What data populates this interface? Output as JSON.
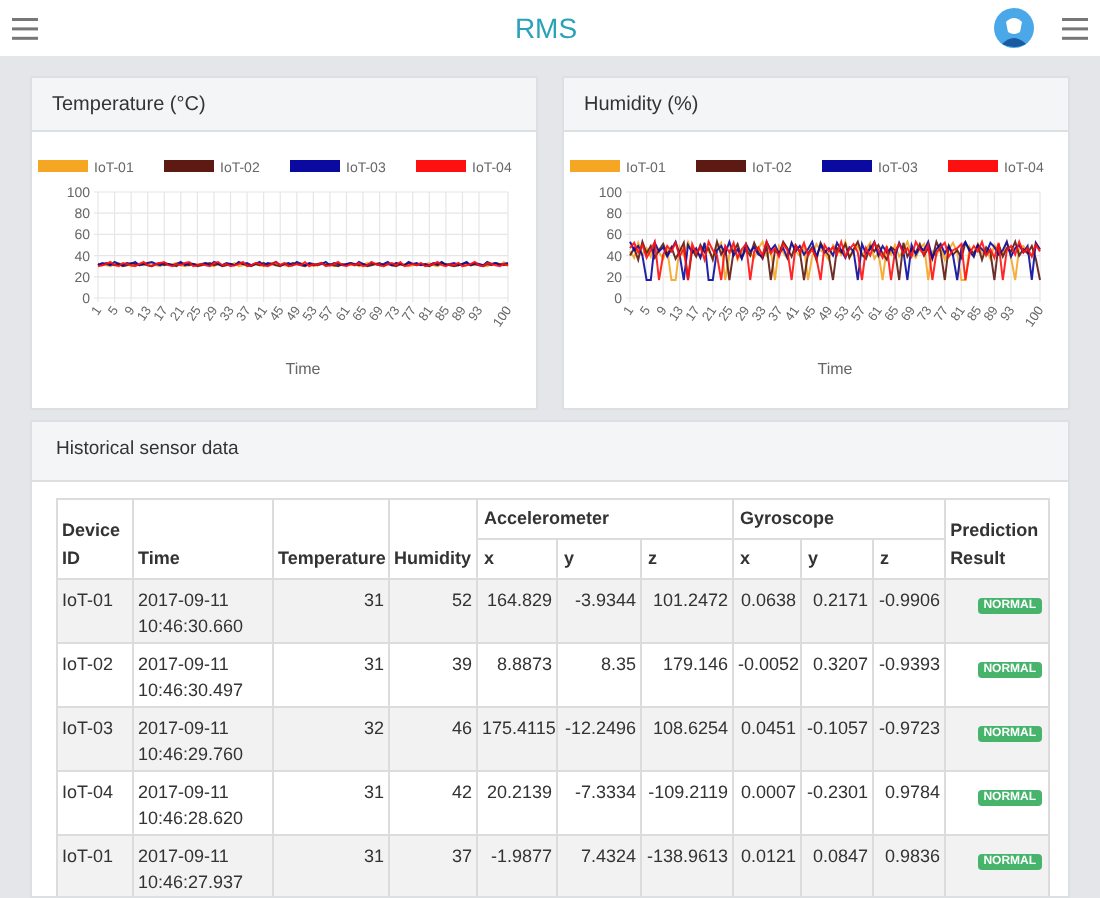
{
  "header": {
    "title": "RMS"
  },
  "charts": [
    {
      "title": "Temperature (°C)",
      "chart_data": {
        "type": "line",
        "grid": true,
        "legend": true,
        "xlim": [
          1,
          100
        ],
        "xlabel": "Time",
        "x": [
          1,
          2,
          3,
          4,
          5,
          6,
          7,
          8,
          9,
          10,
          11,
          12,
          13,
          14,
          15,
          16,
          17,
          18,
          19,
          20,
          21,
          22,
          23,
          24,
          25,
          26,
          27,
          28,
          29,
          30,
          31,
          32,
          33,
          34,
          35,
          36,
          37,
          38,
          39,
          40,
          41,
          42,
          43,
          44,
          45,
          46,
          47,
          48,
          49,
          50,
          51,
          52,
          53,
          54,
          55,
          56,
          57,
          58,
          59,
          60,
          61,
          62,
          63,
          64,
          65,
          66,
          67,
          68,
          69,
          70,
          71,
          72,
          73,
          74,
          75,
          76,
          77,
          78,
          79,
          80,
          81,
          82,
          83,
          84,
          85,
          86,
          87,
          88,
          89,
          90,
          91,
          92,
          93,
          94,
          95,
          96,
          97,
          98,
          99,
          100
        ],
        "ylim": [
          0,
          100
        ],
        "yticks": [
          0,
          20,
          40,
          60,
          80,
          100
        ],
        "xticks": [
          1,
          5,
          9,
          13,
          17,
          21,
          25,
          29,
          33,
          37,
          41,
          45,
          49,
          53,
          57,
          61,
          65,
          69,
          73,
          77,
          81,
          85,
          89,
          93,
          100
        ],
        "series": [
          {
            "name": "IoT-01",
            "color": "#f5a623",
            "values": [
              31,
              32,
              31,
              30,
              32,
              33,
              31,
              32,
              30,
              31,
              32,
              31,
              33,
              32,
              31,
              30,
              32,
              31,
              32,
              33,
              31,
              30,
              31,
              32,
              32,
              31,
              33,
              31,
              30,
              32,
              31,
              32,
              31,
              33,
              30,
              31,
              32,
              31,
              32,
              31,
              30,
              32,
              33,
              31,
              32,
              31,
              30,
              31,
              32,
              33,
              31,
              32,
              30,
              31,
              33,
              32,
              31,
              30,
              32,
              31,
              32,
              31,
              32,
              30,
              31,
              33,
              31,
              32,
              31,
              30,
              32,
              31,
              33,
              31,
              32,
              30,
              31,
              32,
              31,
              32,
              33,
              31,
              30,
              32,
              31,
              32,
              31,
              33,
              30,
              31,
              32,
              31,
              32,
              31,
              30,
              32,
              33,
              31,
              34,
              30
            ]
          },
          {
            "name": "IoT-02",
            "color": "#5c1a12",
            "values": [
              32,
              31,
              33,
              32,
              31,
              32,
              30,
              31,
              33,
              32,
              31,
              32,
              31,
              30,
              32,
              33,
              31,
              32,
              31,
              30,
              33,
              32,
              31,
              32,
              30,
              31,
              32,
              33,
              31,
              32,
              30,
              31,
              32,
              31,
              33,
              32,
              31,
              30,
              32,
              31,
              33,
              31,
              32,
              31,
              30,
              32,
              31,
              33,
              32,
              31,
              30,
              32,
              31,
              32,
              33,
              31,
              32,
              31,
              30,
              32,
              31,
              33,
              32,
              31,
              32,
              30,
              31,
              32,
              33,
              31,
              32,
              31,
              30,
              32,
              31,
              33,
              32,
              31,
              32,
              31,
              30,
              32,
              31,
              33,
              32,
              31,
              30,
              31,
              32,
              33,
              31,
              32,
              31,
              30,
              32,
              31,
              33,
              32,
              31,
              32
            ]
          },
          {
            "name": "IoT-03",
            "color": "#0a0aa0",
            "values": [
              31,
              33,
              32,
              31,
              34,
              32,
              31,
              33,
              32,
              34,
              31,
              32,
              33,
              34,
              32,
              31,
              33,
              32,
              31,
              32,
              34,
              31,
              33,
              32,
              31,
              32,
              33,
              31,
              34,
              32,
              31,
              33,
              32,
              31,
              34,
              32,
              33,
              31,
              32,
              34,
              31,
              33,
              32,
              34,
              31,
              32,
              33,
              31,
              34,
              32,
              31,
              33,
              32,
              31,
              32,
              34,
              31,
              33,
              32,
              31,
              32,
              33,
              31,
              34,
              32,
              31,
              33,
              32,
              31,
              32,
              34,
              31,
              33,
              32,
              31,
              34,
              32,
              33,
              31,
              32,
              31,
              33,
              32,
              34,
              31,
              32,
              33,
              31,
              32,
              34,
              31,
              33,
              32,
              31,
              34,
              32,
              33,
              31,
              32,
              33
            ]
          },
          {
            "name": "IoT-04",
            "color": "#ff1010",
            "values": [
              30,
              31,
              32,
              34,
              31,
              30,
              33,
              32,
              31,
              30,
              32,
              34,
              31,
              30,
              32,
              33,
              34,
              31,
              30,
              32,
              31,
              33,
              34,
              30,
              31,
              32,
              31,
              30,
              33,
              34,
              31,
              32,
              30,
              31,
              32,
              34,
              30,
              31,
              33,
              32,
              31,
              30,
              32,
              34,
              31,
              33,
              30,
              31,
              32,
              31,
              34,
              30,
              32,
              31,
              33,
              30,
              31,
              32,
              34,
              31,
              30,
              32,
              31,
              33,
              30,
              31,
              34,
              32,
              31,
              30,
              32,
              33,
              31,
              34,
              30,
              31,
              32,
              31,
              33,
              30,
              31,
              32,
              34,
              31,
              30,
              32,
              31,
              33,
              30,
              31,
              32,
              34,
              31,
              30,
              33,
              32,
              31,
              30,
              32,
              31
            ]
          }
        ]
      }
    },
    {
      "title": "Humidity (%)",
      "chart_data": {
        "type": "line",
        "grid": true,
        "legend": true,
        "xlim": [
          1,
          100
        ],
        "xlabel": "Time",
        "x": [
          1,
          2,
          3,
          4,
          5,
          6,
          7,
          8,
          9,
          10,
          11,
          12,
          13,
          14,
          15,
          16,
          17,
          18,
          19,
          20,
          21,
          22,
          23,
          24,
          25,
          26,
          27,
          28,
          29,
          30,
          31,
          32,
          33,
          34,
          35,
          36,
          37,
          38,
          39,
          40,
          41,
          42,
          43,
          44,
          45,
          46,
          47,
          48,
          49,
          50,
          51,
          52,
          53,
          54,
          55,
          56,
          57,
          58,
          59,
          60,
          61,
          62,
          63,
          64,
          65,
          66,
          67,
          68,
          69,
          70,
          71,
          72,
          73,
          74,
          75,
          76,
          77,
          78,
          79,
          80,
          81,
          82,
          83,
          84,
          85,
          86,
          87,
          88,
          89,
          90,
          91,
          92,
          93,
          94,
          95,
          96,
          97,
          98,
          99,
          100
        ],
        "ylim": [
          0,
          100
        ],
        "yticks": [
          0,
          20,
          40,
          60,
          80,
          100
        ],
        "xticks": [
          1,
          5,
          9,
          13,
          17,
          21,
          25,
          29,
          33,
          37,
          41,
          45,
          49,
          53,
          57,
          61,
          65,
          69,
          73,
          77,
          81,
          85,
          89,
          93,
          100
        ],
        "series": [
          {
            "name": "IoT-01",
            "color": "#f5a623",
            "values": [
              44,
              38,
              52,
              41,
              47,
              39,
              50,
              43,
              37,
              46,
              17,
              17,
              48,
              40,
              53,
              42,
              45,
              38,
              51,
              44,
              39,
              47,
              52,
              17,
              41,
              49,
              36,
              44,
              50,
              42,
              38,
              47,
              53,
              40,
              45,
              17,
              49,
              43,
              37,
              52,
              44,
              40,
              48,
              17,
              39,
              51,
              45,
              42,
              36,
              50,
              47,
              41,
              53,
              38,
              44,
              49,
              40,
              46,
              52,
              37,
              43,
              17,
              48,
              41,
              50,
              39,
              45,
              53,
              42,
              38,
              47,
              51,
              17,
              44,
              40,
              49,
              36,
              46,
              52,
              43,
              17,
              17,
              48,
              39,
              51,
              42,
              45,
              37,
              50,
              44,
              41,
              53,
              38,
              17,
              47,
              49,
              43,
              40,
              52,
              45
            ]
          },
          {
            "name": "IoT-02",
            "color": "#5c1a12",
            "values": [
              40,
              47,
              36,
              53,
              42,
              49,
              38,
              45,
              51,
              41,
              48,
              37,
              44,
              52,
              17,
              46,
              39,
              50,
              43,
              47,
              36,
              53,
              41,
              48,
              17,
              44,
              51,
              38,
              46,
              40,
              52,
              43,
              37,
              49,
              17,
              45,
              41,
              53,
              47,
              39,
              50,
              44,
              17,
              42,
              48,
              36,
              52,
              45,
              40,
              17,
              47,
              43,
              51,
              38,
              46,
              53,
              41,
              37,
              49,
              44,
              50,
              42,
              36,
              48,
              45,
              17,
              52,
              39,
              46,
              43,
              51,
              40,
              47,
              37,
              53,
              44,
              17,
              49,
              41,
              45,
              38,
              52,
              46,
              42,
              50,
              36,
              48,
              43,
              17,
              51,
              39,
              47,
              44,
              53,
              40,
              46,
              42,
              49,
              37,
              17
            ]
          },
          {
            "name": "IoT-03",
            "color": "#0a0aa0",
            "values": [
              53,
              45,
              49,
              40,
              17,
              17,
              52,
              44,
              48,
              39,
              46,
              53,
              41,
              17,
              50,
              43,
              47,
              38,
              52,
              17,
              17,
              45,
              49,
              42,
              53,
              40,
              46,
              37,
              51,
              44,
              48,
              41,
              39,
              53,
              45,
              50,
              42,
              47,
              38,
              52,
              44,
              49,
              41,
              46,
              53,
              39,
              50,
              43,
              47,
              40,
              52,
              45,
              38,
              48,
              44,
              17,
              51,
              42,
              46,
              53,
              40,
              49,
              43,
              47,
              39,
              52,
              44,
              17,
              50,
              41,
              48,
              45,
              53,
              38,
              46,
              51,
              42,
              49,
              40,
              17,
              47,
              53,
              44,
              39,
              50,
              46,
              42,
              52,
              48,
              41,
              45,
              53,
              39,
              47,
              50,
              43,
              49,
              17,
              52,
              46
            ]
          },
          {
            "name": "IoT-04",
            "color": "#ff1010",
            "values": [
              47,
              52,
              43,
              50,
              38,
              45,
              53,
              17,
              41,
              49,
              44,
              52,
              39,
              47,
              17,
              51,
              42,
              48,
              36,
              53,
              45,
              40,
              17,
              49,
              43,
              52,
              38,
              46,
              51,
              17,
              44,
              48,
              40,
              53,
              42,
              47,
              39,
              51,
              45,
              17,
              49,
              43,
              52,
              40,
              46,
              38,
              17,
              50,
              44,
              48,
              41,
              53,
              39,
              46,
              51,
              43,
              17,
              47,
              40,
              52,
              45,
              38,
              49,
              17,
              44,
              51,
              42,
              47,
              39,
              53,
              46,
              41,
              50,
              17,
              43,
              48,
              52,
              39,
              45,
              47,
              51,
              17,
              42,
              49,
              44,
              53,
              40,
              46,
              38,
              52,
              17,
              45,
              49,
              41,
              53,
              43,
              47,
              39,
              50,
              44
            ]
          }
        ]
      }
    }
  ],
  "table": {
    "title": "Historical sensor data",
    "header_rows": [
      [
        {
          "text": "Device ID",
          "rowspan": 2
        },
        {
          "text": "Time",
          "rowspan": 2
        },
        {
          "text": "Temperature",
          "rowspan": 2
        },
        {
          "text": "Humidity",
          "rowspan": 2
        },
        {
          "text": "Accelerometer",
          "colspan": 3
        },
        {
          "text": "Gyroscope",
          "colspan": 3
        },
        {
          "text": "Prediction Result",
          "rowspan": 2
        }
      ],
      [
        {
          "text": "x"
        },
        {
          "text": "y"
        },
        {
          "text": "z"
        },
        {
          "text": "x"
        },
        {
          "text": "y"
        },
        {
          "text": "z"
        }
      ]
    ],
    "rows": [
      {
        "cells": [
          "IoT-01",
          "2017-09-11 10:46:30.660",
          "31",
          "52",
          "164.829",
          "-3.9344",
          "101.2472",
          "0.0638",
          "0.2171",
          "-0.9906"
        ],
        "result": "NORMAL"
      },
      {
        "cells": [
          "IoT-02",
          "2017-09-11 10:46:30.497",
          "31",
          "39",
          "8.8873",
          "8.35",
          "179.146",
          "-0.0052",
          "0.3207",
          "-0.9393"
        ],
        "result": "NORMAL"
      },
      {
        "cells": [
          "IoT-03",
          "2017-09-11 10:46:29.760",
          "32",
          "46",
          "175.4115",
          "-12.2496",
          "108.6254",
          "0.0451",
          "-0.1057",
          "-0.9723"
        ],
        "result": "NORMAL"
      },
      {
        "cells": [
          "IoT-04",
          "2017-09-11 10:46:28.620",
          "31",
          "42",
          "20.2139",
          "-7.3334",
          "-109.2119",
          "0.0007",
          "-0.2301",
          "0.9784"
        ],
        "result": "NORMAL"
      },
      {
        "cells": [
          "IoT-01",
          "2017-09-11 10:46:27.937",
          "31",
          "37",
          "-1.9877",
          "7.4324",
          "-138.9613",
          "0.0121",
          "0.0847",
          "0.9836"
        ],
        "result": "NORMAL"
      }
    ]
  }
}
